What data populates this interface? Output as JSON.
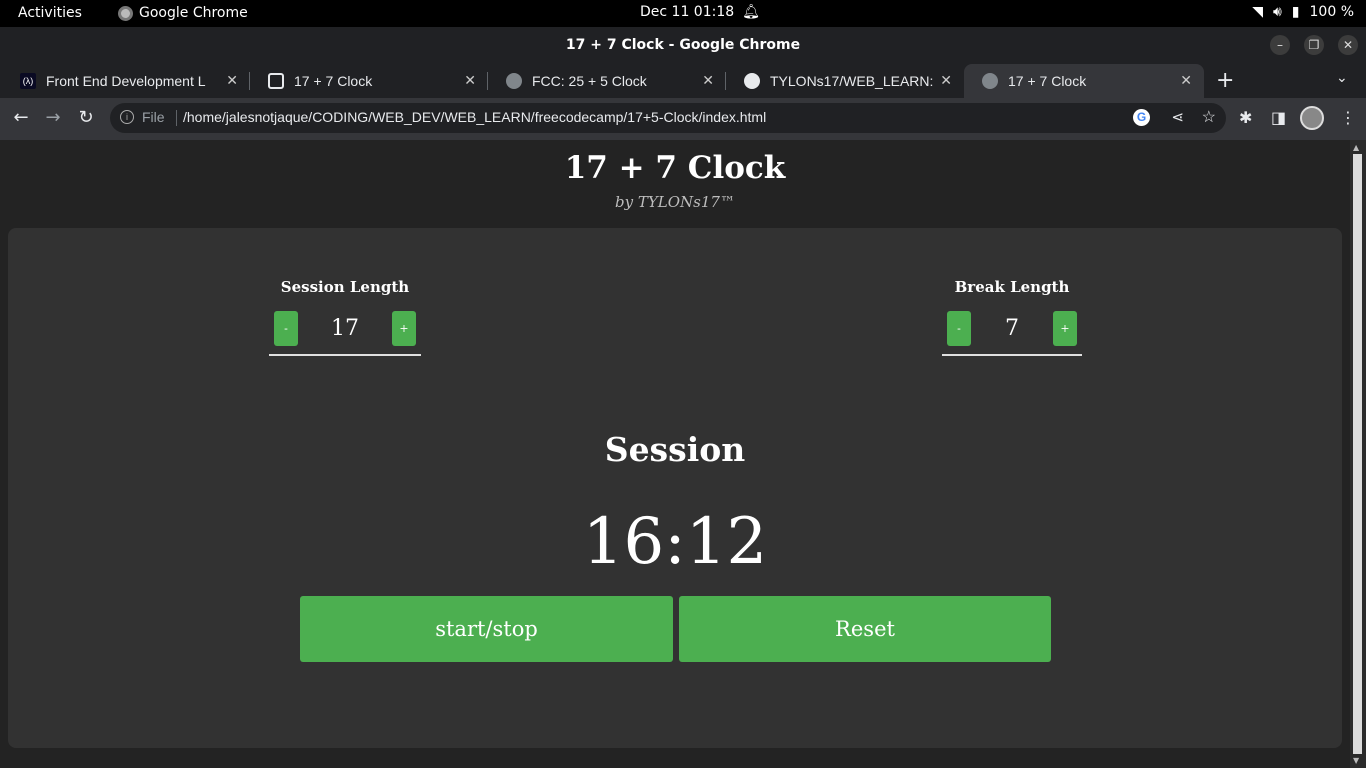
{
  "os": {
    "activities": "Activities",
    "app_name": "Google Chrome",
    "datetime": "Dec 11  01:18",
    "battery": "100 %"
  },
  "window": {
    "title": "17 + 7 Clock - Google Chrome"
  },
  "tabs": [
    {
      "label": "Front End Development L",
      "favicon": "fcc-icon",
      "active": false
    },
    {
      "label": "17 + 7 Clock",
      "favicon": "codepen-icon",
      "active": false
    },
    {
      "label": "FCC: 25 + 5 Clock",
      "favicon": "globe-icon",
      "active": false
    },
    {
      "label": "TYLONs17/WEB_LEARN: ",
      "favicon": "github-icon",
      "active": false
    },
    {
      "label": "17 + 7 Clock",
      "favicon": "globe-icon",
      "active": true
    }
  ],
  "toolbar": {
    "file_label": "File",
    "url": "/home/jalesnotjaque/CODING/WEB_DEV/WEB_LEARN/freecodecamp/17+5-Clock/index.html"
  },
  "app": {
    "title": "17 + 7 Clock",
    "byline": "by TYLONs17™",
    "session": {
      "label": "Session Length",
      "value": "17",
      "minus": "-",
      "plus": "+"
    },
    "break": {
      "label": "Break Length",
      "value": "7",
      "minus": "-",
      "plus": "+"
    },
    "status": "Session",
    "time_left": "16:12",
    "start_stop": "start/stop",
    "reset": "Reset"
  },
  "colors": {
    "accent": "#4caf50",
    "card": "#323232",
    "page": "#232323"
  }
}
